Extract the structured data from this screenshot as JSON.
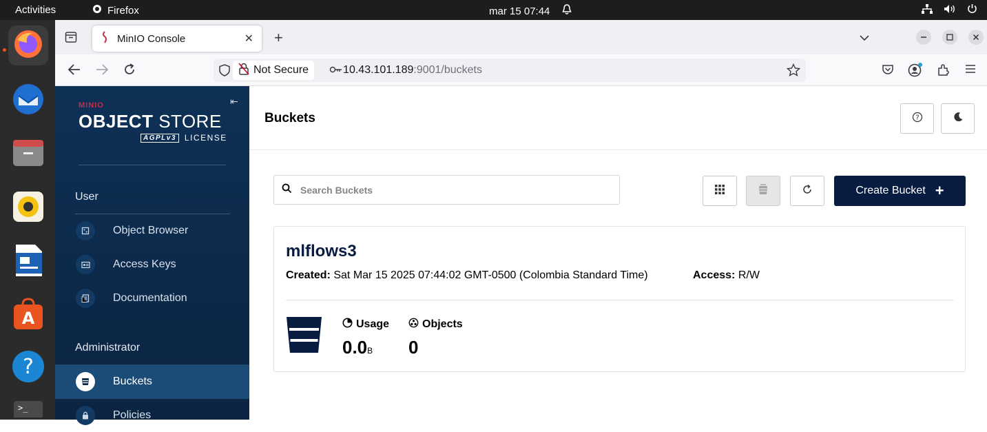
{
  "topbar": {
    "activities": "Activities",
    "app": "Firefox",
    "clock": "mar 15  07:44"
  },
  "browser": {
    "tab_title": "MinIO Console",
    "not_secure": "Not Secure",
    "url_host": "10.43.101.189",
    "url_rest": ":9001/buckets"
  },
  "sidebar": {
    "logo_small": "MINIO",
    "logo_object": "OBJECT",
    "logo_store": " STORE",
    "logo_agpl": "AGPLv3",
    "logo_license": "LICENSE",
    "user_label": "User",
    "user_items": [
      {
        "label": "Object Browser"
      },
      {
        "label": "Access Keys"
      },
      {
        "label": "Documentation"
      }
    ],
    "admin_label": "Administrator",
    "admin_items": [
      {
        "label": "Buckets"
      },
      {
        "label": "Policies"
      }
    ]
  },
  "main": {
    "title": "Buckets",
    "search_placeholder": "Search Buckets",
    "create_label": "Create Bucket"
  },
  "bucket": {
    "name": "mlflows3",
    "created_label": "Created:",
    "created_value": " Sat Mar 15 2025 07:44:02 GMT-0500 (Colombia Standard Time)",
    "access_label": "Access:",
    "access_value": " R/W",
    "usage_label": "Usage",
    "usage_value": "0.0",
    "usage_unit": "B",
    "objects_label": "Objects",
    "objects_value": "0"
  },
  "colors": {
    "sidebar_bg": "#0b2a4d",
    "primary": "#081c42",
    "logo_accent": "#c72c48"
  }
}
